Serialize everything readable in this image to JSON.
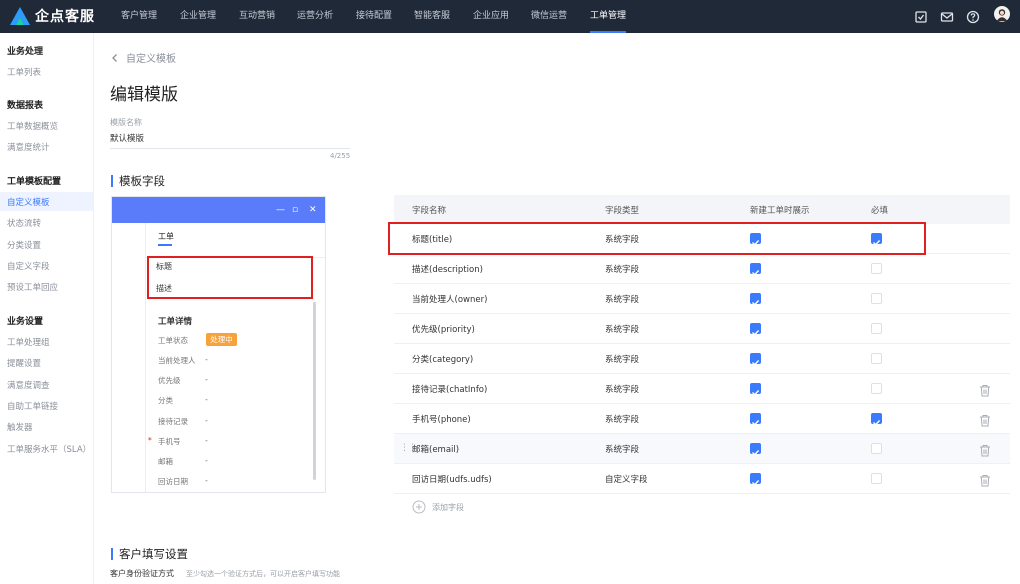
{
  "app": {
    "name": "企点客服"
  },
  "nav": {
    "items": [
      "客户管理",
      "企业管理",
      "互动营销",
      "运营分析",
      "接待配置",
      "智能客服",
      "企业应用",
      "微信运营",
      "工单管理"
    ]
  },
  "sidebar": {
    "groups": [
      {
        "title": "业务处理",
        "items": [
          "工单列表"
        ]
      },
      {
        "title": "数据报表",
        "items": [
          "工单数据概览",
          "满意度统计"
        ]
      },
      {
        "title": "工单模板配置",
        "items": [
          "自定义模板",
          "状态流转",
          "分类设置",
          "自定义字段",
          "预设工单回应"
        ]
      },
      {
        "title": "业务设置",
        "items": [
          "工单处理组",
          "提醒设置",
          "满意度调查",
          "自助工单链接",
          "触发器",
          "工单服务水平（SLA）"
        ]
      }
    ]
  },
  "breadcrumb": "自定义模板",
  "page_title": "编辑模版",
  "template_name": {
    "label": "模版名称",
    "value": "默认模版",
    "count": "4/255"
  },
  "fields_section": {
    "title": "模板字段"
  },
  "preview": {
    "tab": "工单",
    "title_field": "标题",
    "desc_field": "描述",
    "detail_heading": "工单详情",
    "status_label": "工单状态",
    "status_value": "处理中",
    "labels": [
      "当前处理人",
      "优先级",
      "分类",
      "接待记录",
      "手机号",
      "邮箱",
      "回访日期"
    ],
    "dash": "-",
    "required_mark": "*"
  },
  "table": {
    "headers": [
      "字段名称",
      "字段类型",
      "新建工单时展示",
      "必填"
    ],
    "rows": [
      {
        "name": "标题(title)",
        "type": "系统字段",
        "show": true,
        "required": true,
        "deletable": false
      },
      {
        "name": "描述(description)",
        "type": "系统字段",
        "show": true,
        "required": false,
        "deletable": false
      },
      {
        "name": "当前处理人(owner)",
        "type": "系统字段",
        "show": true,
        "required": false,
        "deletable": false
      },
      {
        "name": "优先级(priority)",
        "type": "系统字段",
        "show": true,
        "required": false,
        "deletable": false
      },
      {
        "name": "分类(category)",
        "type": "系统字段",
        "show": true,
        "required": false,
        "deletable": false
      },
      {
        "name": "接待记录(chatInfo)",
        "type": "系统字段",
        "show": true,
        "required": false,
        "deletable": true
      },
      {
        "name": "手机号(phone)",
        "type": "系统字段",
        "show": true,
        "required": true,
        "deletable": true
      },
      {
        "name": "邮箱(email)",
        "type": "系统字段",
        "show": true,
        "required": false,
        "deletable": true
      },
      {
        "name": "回访日期(udfs.udfs)",
        "type": "自定义字段",
        "show": true,
        "required": false,
        "deletable": true
      }
    ],
    "add_label": "添加字段"
  },
  "customer_section": {
    "title": "客户填写设置",
    "label": "客户身份验证方式",
    "hint": "至少勾选一个验证方式后，可以开启客户填写功能"
  },
  "colors": {
    "accent": "#3a7bfd",
    "nav_bg": "#202938",
    "highlight": "#e02020",
    "badge": "#f7a23b"
  }
}
